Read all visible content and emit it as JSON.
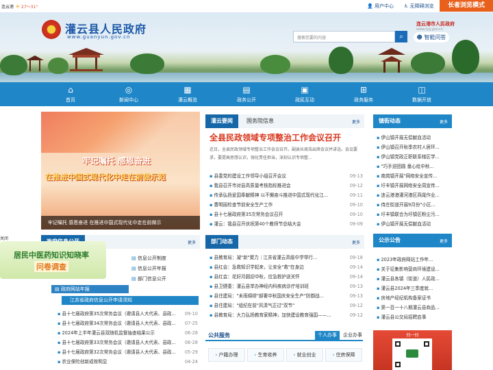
{
  "topbar": {
    "weather_city": "连云港",
    "weather_temp": "27～31°",
    "user_center": "用户中心",
    "accessibility": "无障碍浏览",
    "elder_mode": "长者浏览模式"
  },
  "header": {
    "site_title": "灌云县人民政府",
    "site_url": "www.guanyun.gov.cn",
    "partner_title": "连云港市人民政府",
    "partner_url": "www.lyg.gov.cn",
    "search_placeholder": "搜索您要的内容",
    "smart_qa": "智能问答"
  },
  "nav": {
    "items": [
      {
        "label": "首页",
        "icon": "home-icon",
        "glyph": "⌂"
      },
      {
        "label": "新闻中心",
        "icon": "globe-icon",
        "glyph": "◎"
      },
      {
        "label": "灌云概览",
        "icon": "building-icon",
        "glyph": "▦"
      },
      {
        "label": "政务公开",
        "icon": "document-icon",
        "glyph": "▤"
      },
      {
        "label": "政民互动",
        "icon": "briefcase-icon",
        "glyph": "▣"
      },
      {
        "label": "政务服务",
        "icon": "network-icon",
        "glyph": "⊞"
      },
      {
        "label": "数据开放",
        "icon": "data-icon",
        "glyph": "◫"
      }
    ]
  },
  "slide": {
    "slogan_line1": "牢记嘱托 感恩奋进",
    "slogan_line2": "在推进中国式现代化中走在前做示范",
    "caption": "牢记嘱托 感恩奋进 在推进中国式现代化中走在前做示"
  },
  "float_ad": {
    "close": "关闭",
    "line1": "居民中医药知识知晓率",
    "line2": "问卷调查"
  },
  "news": {
    "tab_active": "灌云要闻",
    "tab_other": "国务院信息",
    "more": "更多",
    "headline": "全县民政领域专项整治工作会议召开",
    "summary": "近日，全县民政领域专项整治工作会议召开。副县长周浩出席会议并讲话。会议要求，要提高思想认识，强化责任担当，深刻认识专项整...",
    "items": [
      {
        "title": "县委党的建设工作领导小组召开会议",
        "date": "09-13"
      },
      {
        "title": "我县召开市对县高质量考核指标推进会",
        "date": "09-12"
      },
      {
        "title": "传承弘扬爱国奉献精神 以不懈奋斗推进中国式现代化江...",
        "date": "09-11"
      },
      {
        "title": "曹明丽检查节前安全生产工作",
        "date": "09-10"
      },
      {
        "title": "县十七届政府第35次常务会议召开",
        "date": "09-10"
      },
      {
        "title": "灌云：我县召开庆祝第40个教师节总结大会",
        "date": "09-09"
      }
    ]
  },
  "town": {
    "title": "镇街动态",
    "more": "更多",
    "items": [
      "伊山镇开展无偿献血活动",
      "伊山镇召开秋季农村人居环...",
      "伊山镇党政正职联系辖区学...",
      "\"巧手迎团圆 童心绘中秋...",
      "南岗镇开展\"网络安全宣传...",
      "圩丰镇开展网络安全周宣传...",
      "连云港港灌河港区燕尾作业...",
      "侍庄街道开展9月份\"小区...",
      "圩丰镇联合为圩镇区粉尘污...",
      "伊山镇开展无偿献血活动"
    ]
  },
  "gov_open": {
    "title": "政府信息公开",
    "more": "更多",
    "sub_system": "信息公开制度",
    "sub_annual": "信息公开年报",
    "sub_dept": "部门信息公开",
    "sub_report": "政府网站年报",
    "notice": "江苏省政府信息公开申请须知",
    "items": [
      {
        "title": "县十七届政府第35次常务会议（邀请县人大代表、县政...",
        "date": "09-10"
      },
      {
        "title": "县十七届政府第34次常务会议（邀请县人大代表、县政...",
        "date": "07-25"
      },
      {
        "title": "2024年上半年灌云县双随机监督抽查结果公示",
        "date": "06-28"
      },
      {
        "title": "县十七届政府第33次常务会议（邀请县人大代表、县政...",
        "date": "06-28"
      },
      {
        "title": "县十七届政府第32次常务会议（邀请县人大代表、县政...",
        "date": "05-29"
      },
      {
        "title": "农业保险创新成效明显",
        "date": "04-24"
      }
    ]
  },
  "dept": {
    "title": "部门动态",
    "more": "更多",
    "items": [
      {
        "title": "县教育局：凝\"新\"聚力｜江苏省灌云高级中学举行...",
        "date": "09-18"
      },
      {
        "title": "县红会：急救知识学起来，让安全\"救\"在身边",
        "date": "09-14"
      },
      {
        "title": "县红会：花好月圆迎中秋，应急救护送关怀",
        "date": "09-14"
      },
      {
        "title": "县卫健委：灌云县举办神经内科疾病诊疗培训班",
        "date": "09-13"
      },
      {
        "title": "县住建局：\"未雨绸缪\"部署中秋国庆安全生产\"防御战...",
        "date": "09-13"
      },
      {
        "title": "县住建局：\"组纪在前\"风清气正过\"双节\"",
        "date": "09-12"
      },
      {
        "title": "县教育局：大力弘扬教育家精神，加快建设教育强国——...",
        "date": "09-12"
      }
    ]
  },
  "public_notice": {
    "title": "公示公告",
    "more": "更多",
    "items": [
      "2023年政府网站工作年...",
      "关于征集影响营商环境建设...",
      "灌云县各镇（街道）人民政...",
      "灌云县2024年三季度就...",
      "房地产经纪机构备案证书",
      "第一百一十八期灌云县商品...",
      "灌云县公交局招聘启事"
    ]
  },
  "service": {
    "title": "公共服务",
    "tab_personal": "个人办事",
    "tab_corporate": "企业办事",
    "items": [
      "户籍办理",
      "生育收养",
      "就业创业",
      "住房保障"
    ]
  },
  "qr": {
    "label": "扫一扫"
  }
}
